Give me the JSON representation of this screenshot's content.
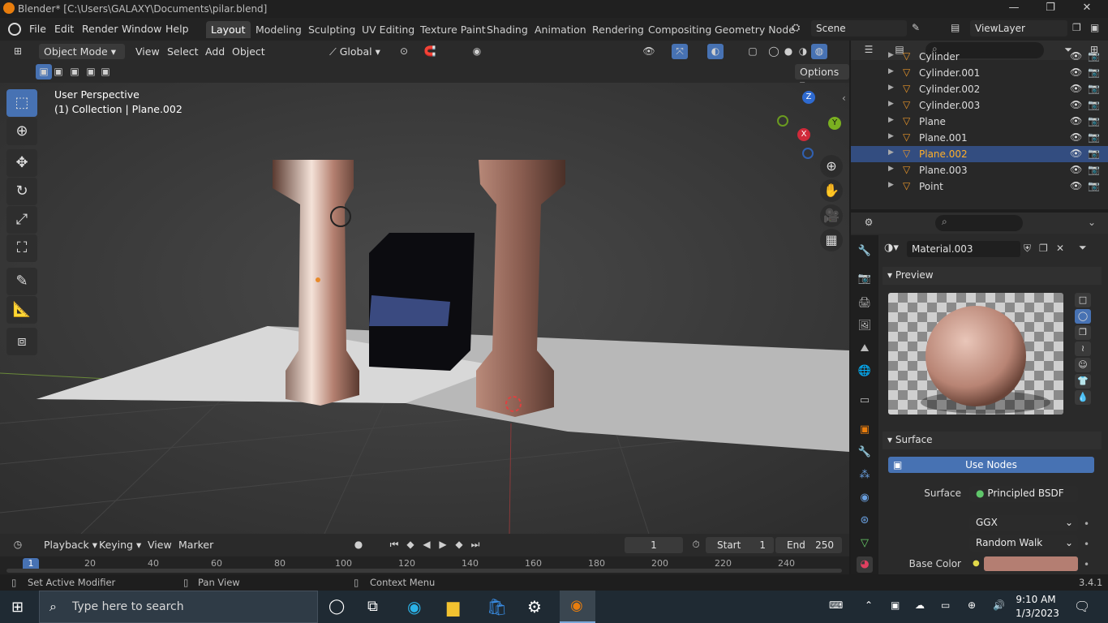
{
  "titlebar": {
    "title": "Blender* [C:\\Users\\GALAXY\\Documents\\pilar.blend]",
    "minimize": "—",
    "maximize": "❐",
    "close": "✕"
  },
  "menubar": {
    "menus": [
      "File",
      "Edit",
      "Render",
      "Window",
      "Help"
    ],
    "workspaces": [
      "Layout",
      "Modeling",
      "Sculpting",
      "UV Editing",
      "Texture Paint",
      "Shading",
      "Animation",
      "Rendering",
      "Compositing",
      "Geometry Node"
    ],
    "active_workspace": "Layout",
    "scene": "Scene",
    "view_layer": "ViewLayer"
  },
  "viewport_header": {
    "mode": "Object Mode",
    "menus": [
      "View",
      "Select",
      "Add",
      "Object"
    ],
    "transform_orientation": "Global",
    "options": "Options"
  },
  "viewport": {
    "perspective": "User Perspective",
    "collection": "(1) Collection | Plane.002",
    "gizmo": {
      "z": "Z",
      "y": "Y",
      "x": "X"
    }
  },
  "timeline": {
    "menus": [
      "Playback",
      "Keying",
      "View",
      "Marker"
    ],
    "current_frame": "1",
    "start_label": "Start",
    "start": "1",
    "end_label": "End",
    "end": "250",
    "ruler_current": "1",
    "ruler": [
      "20",
      "40",
      "60",
      "80",
      "100",
      "120",
      "140",
      "160",
      "180",
      "200",
      "220",
      "240"
    ]
  },
  "statusbar": {
    "left": "Set Active Modifier",
    "middle": "Pan View",
    "right": "Context Menu",
    "version": "3.4.1"
  },
  "outliner": {
    "items": [
      {
        "name": "Cylinder",
        "selected": false
      },
      {
        "name": "Cylinder.001",
        "selected": false
      },
      {
        "name": "Cylinder.002",
        "selected": false
      },
      {
        "name": "Cylinder.003",
        "selected": false
      },
      {
        "name": "Plane",
        "selected": false
      },
      {
        "name": "Plane.001",
        "selected": false
      },
      {
        "name": "Plane.002",
        "selected": true
      },
      {
        "name": "Plane.003",
        "selected": false
      },
      {
        "name": "Point",
        "selected": false
      }
    ]
  },
  "properties": {
    "material": "Material.003",
    "preview_title": "Preview",
    "surface_title": "Surface",
    "use_nodes": "Use Nodes",
    "surface_label": "Surface",
    "surface_value": "Principled BSDF",
    "distribution": "GGX",
    "subsurface_method": "Random Walk",
    "base_color_label": "Base Color",
    "base_color_hex": "#b47e72"
  },
  "taskbar": {
    "search_placeholder": "Type here to search",
    "time": "9:10 AM",
    "date": "1/3/2023"
  },
  "colors": {
    "accent": "#4772b3",
    "selected_text": "#ffaf29",
    "blender_orange": "#e87d0d"
  }
}
